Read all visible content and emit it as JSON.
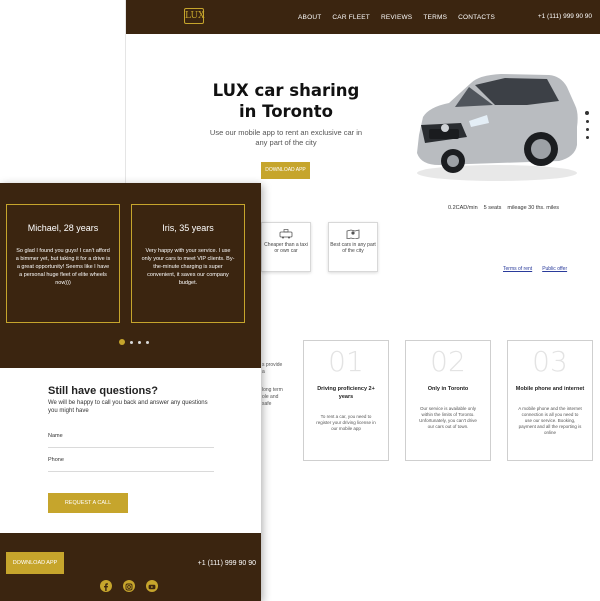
{
  "brand": {
    "logo_text": "LUX",
    "accent": "#c6a52c",
    "dark": "#3b2510"
  },
  "desktop": {
    "nav": [
      "ABOUT",
      "CAR FLEET",
      "REVIEWS",
      "TERMS",
      "CONTACTS"
    ],
    "phone": "+1 (111) 999 90 90",
    "hero": {
      "title": "LUX car sharing in Toronto",
      "subtitle": "Use our mobile app to rent an exclusive car in any part of the city",
      "button": "DOWNLOAD APP"
    },
    "specs": [
      "0.2CAD/min",
      "5 seats",
      "mileage 30 ths. miles"
    ],
    "features": [
      "Cheaper than a taxi or own car",
      "Best cars in any part of the city"
    ],
    "links": [
      "Terms of rent",
      "Public offer"
    ],
    "peek_text": [
      "s provide a",
      "long term",
      "ole and safe"
    ],
    "conditions": [
      {
        "num": "01",
        "title": "Driving proficiency 2+ years",
        "text": "To rent a car, you need to register your driving license in our mobile app"
      },
      {
        "num": "02",
        "title": "Only in Toronto",
        "text": "Our service is available only within the limits of Toronto. Unfortunately, you can't drive our cars out of town."
      },
      {
        "num": "03",
        "title": "Mobile phone and internet",
        "text": "A mobile phone and the internet connection is all you need to use our service. Booking, payment and all the reporting is online"
      }
    ]
  },
  "mobile": {
    "reviews": [
      {
        "name": "Michael, 28 years",
        "text": "So glad I found you guys! I can't afford a bimmer yet, but taking it for a drive is a great opportunity! Seems like I have a personal huge fleet of elite wheels now)))"
      },
      {
        "name": "Iris, 35 years",
        "text": "Very happy with your service. I use only your cars to meet VIP clients. By-the-minute charging is super convenient, it saves our company budget."
      }
    ],
    "questions": {
      "title": "Still have questions?",
      "subtitle": "We will be happy to call you back and answer any questions you might have",
      "name_label": "Name",
      "phone_label": "Phone",
      "button": "REQUEST A CALL"
    },
    "footer": {
      "button": "DOWNLOAD APP",
      "phone": "+1 (111) 999 90 90",
      "social": [
        "facebook-icon",
        "instagram-icon",
        "youtube-icon"
      ]
    }
  }
}
